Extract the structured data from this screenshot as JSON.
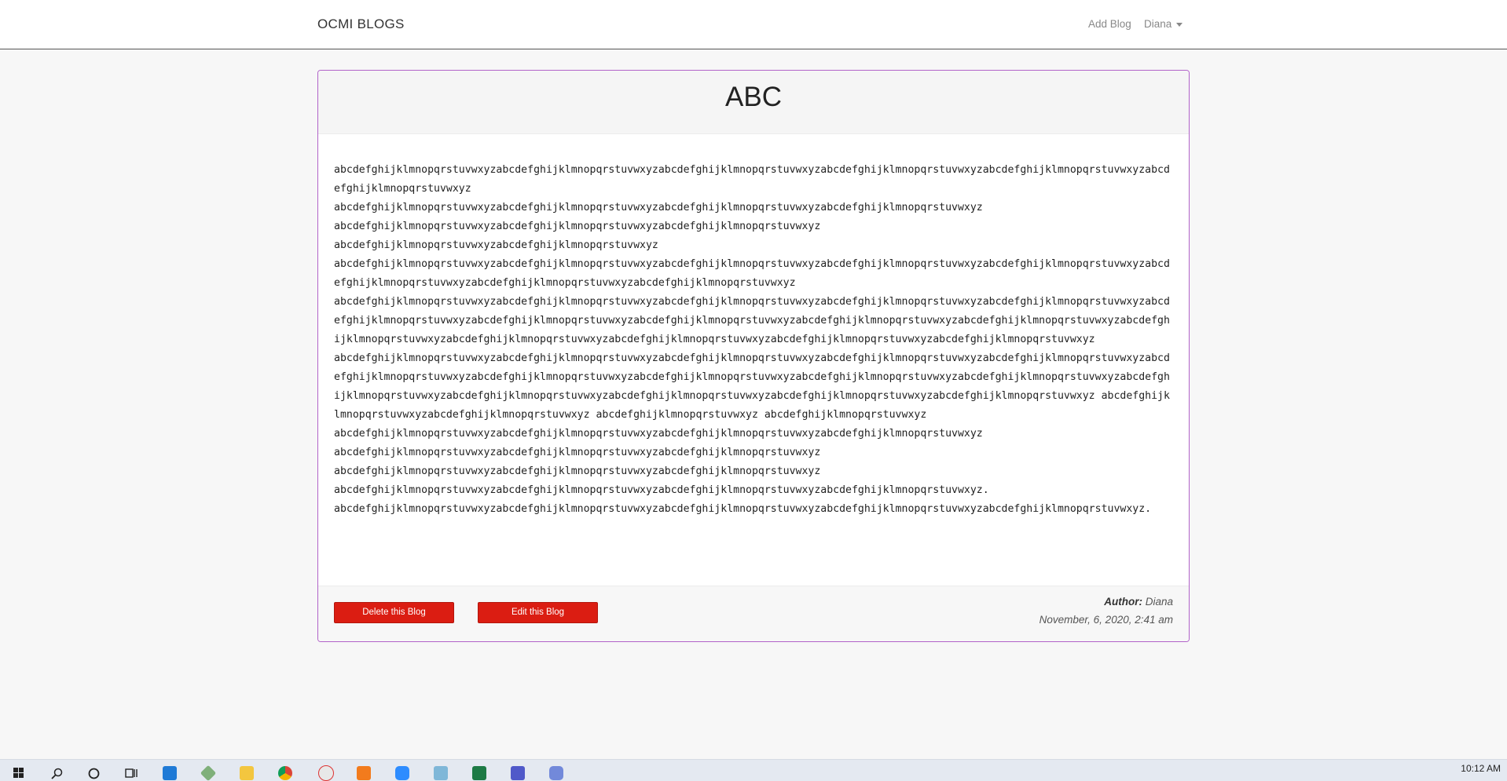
{
  "navbar": {
    "brand": "OCMI BLOGS",
    "add_blog": "Add Blog",
    "user": "Diana"
  },
  "blog": {
    "title": "ABC",
    "paragraphs": [
      "abcdefghijklmnopqrstuvwxyzabcdefghijklmnopqrstuvwxyzabcdefghijklmnopqrstuvwxyzabcdefghijklmnopqrstuvwxyzabcdefghijklmnopqrstuvwxyzabcdefghijklmnopqrstuvwxyz",
      "abcdefghijklmnopqrstuvwxyzabcdefghijklmnopqrstuvwxyzabcdefghijklmnopqrstuvwxyzabcdefghijklmnopqrstuvwxyz",
      "abcdefghijklmnopqrstuvwxyzabcdefghijklmnopqrstuvwxyzabcdefghijklmnopqrstuvwxyz",
      "abcdefghijklmnopqrstuvwxyzabcdefghijklmnopqrstuvwxyz",
      "abcdefghijklmnopqrstuvwxyzabcdefghijklmnopqrstuvwxyzabcdefghijklmnopqrstuvwxyzabcdefghijklmnopqrstuvwxyzabcdefghijklmnopqrstuvwxyzabcdefghijklmnopqrstuvwxyzabcdefghijklmnopqrstuvwxyzabcdefghijklmnopqrstuvwxyz",
      "abcdefghijklmnopqrstuvwxyzabcdefghijklmnopqrstuvwxyzabcdefghijklmnopqrstuvwxyzabcdefghijklmnopqrstuvwxyzabcdefghijklmnopqrstuvwxyzabcdefghijklmnopqrstuvwxyzabcdefghijklmnopqrstuvwxyzabcdefghijklmnopqrstuvwxyzabcdefghijklmnopqrstuvwxyzabcdefghijklmnopqrstuvwxyzabcdefghijklmnopqrstuvwxyzabcdefghijklmnopqrstuvwxyzabcdefghijklmnopqrstuvwxyzabcdefghijklmnopqrstuvwxyzabcdefghijklmnopqrstuvwxyz",
      "abcdefghijklmnopqrstuvwxyzabcdefghijklmnopqrstuvwxyzabcdefghijklmnopqrstuvwxyzabcdefghijklmnopqrstuvwxyzabcdefghijklmnopqrstuvwxyzabcdefghijklmnopqrstuvwxyzabcdefghijklmnopqrstuvwxyzabcdefghijklmnopqrstuvwxyzabcdefghijklmnopqrstuvwxyzabcdefghijklmnopqrstuvwxyzabcdefghijklmnopqrstuvwxyzabcdefghijklmnopqrstuvwxyzabcdefghijklmnopqrstuvwxyzabcdefghijklmnopqrstuvwxyzabcdefghijklmnopqrstuvwxyz abcdefghijklmnopqrstuvwxyzabcdefghijklmnopqrstuvwxyz abcdefghijklmnopqrstuvwxyz abcdefghijklmnopqrstuvwxyz",
      "abcdefghijklmnopqrstuvwxyzabcdefghijklmnopqrstuvwxyzabcdefghijklmnopqrstuvwxyzabcdefghijklmnopqrstuvwxyz",
      "abcdefghijklmnopqrstuvwxyzabcdefghijklmnopqrstuvwxyzabcdefghijklmnopqrstuvwxyz",
      "abcdefghijklmnopqrstuvwxyzabcdefghijklmnopqrstuvwxyzabcdefghijklmnopqrstuvwxyz",
      "abcdefghijklmnopqrstuvwxyzabcdefghijklmnopqrstuvwxyzabcdefghijklmnopqrstuvwxyzabcdefghijklmnopqrstuvwxyz.",
      "abcdefghijklmnopqrstuvwxyzabcdefghijklmnopqrstuvwxyzabcdefghijklmnopqrstuvwxyzabcdefghijklmnopqrstuvwxyzabcdefghijklmnopqrstuvwxyz."
    ],
    "delete_label": "Delete this Blog",
    "edit_label": "Edit this Blog",
    "author_label": "Author:",
    "author_name": "Diana",
    "date": "November, 6, 2020, 2:41 am"
  },
  "taskbar": {
    "time": "10:12 AM",
    "icons": [
      "windows-start-icon",
      "search-icon",
      "cortana-icon",
      "task-view-icon",
      "vscode-icon",
      "app-icon",
      "file-explorer-icon",
      "chrome-icon",
      "paint-icon",
      "xampp-icon",
      "zoom-icon",
      "notepad-icon",
      "excel-icon",
      "teams-icon",
      "discord-icon"
    ],
    "colors": {
      "accent": "#b163c9",
      "button": "#db1d12"
    }
  }
}
